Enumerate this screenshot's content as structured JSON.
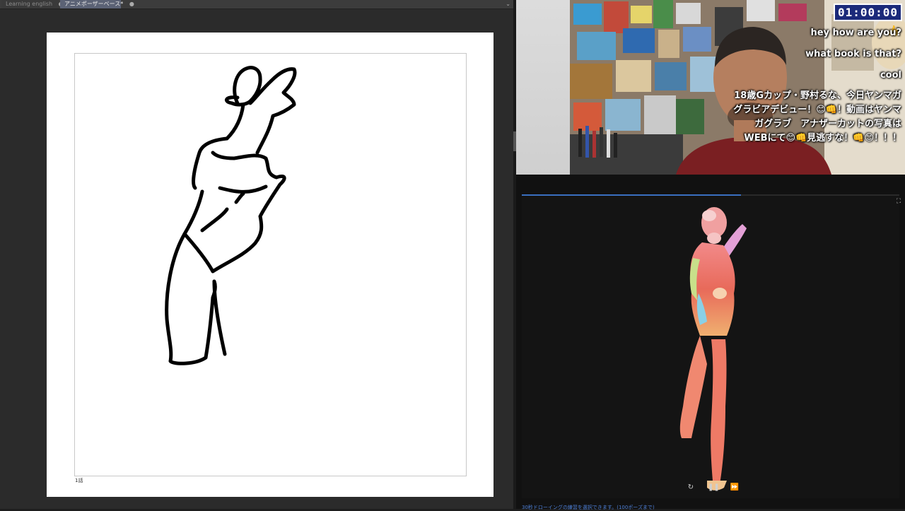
{
  "tabs": [
    {
      "label": "Learning english",
      "close": "●"
    },
    {
      "label": "アニメポーザーベース*",
      "close": "●"
    }
  ],
  "tab_menu_icon": "chevron-down-icon",
  "canvas": {
    "page_label": "1話"
  },
  "stream": {
    "timer": "01:00:00",
    "chat": [
      "hey how are you?",
      "what book is that?",
      "cool",
      "18歳Gカップ・野村るな、今日ヤンマガグラビアデビュー！😊👊！動画はヤンマガグラブ　アナザーカットの写真はWEBにて😊👊見逃すな！👊😊！！！"
    ],
    "chat_icon": "thumbs-up-icon"
  },
  "model_viewer": {
    "progress": 0.58,
    "controls": [
      "replay-icon",
      "pause-icon",
      "skip-icon"
    ],
    "footer": "30秒ドローイングの練習を選択できます。(100ポーズまで)"
  },
  "colors": {
    "accent": "#3a6fc0",
    "timer_bg": "#1b2a7a"
  }
}
